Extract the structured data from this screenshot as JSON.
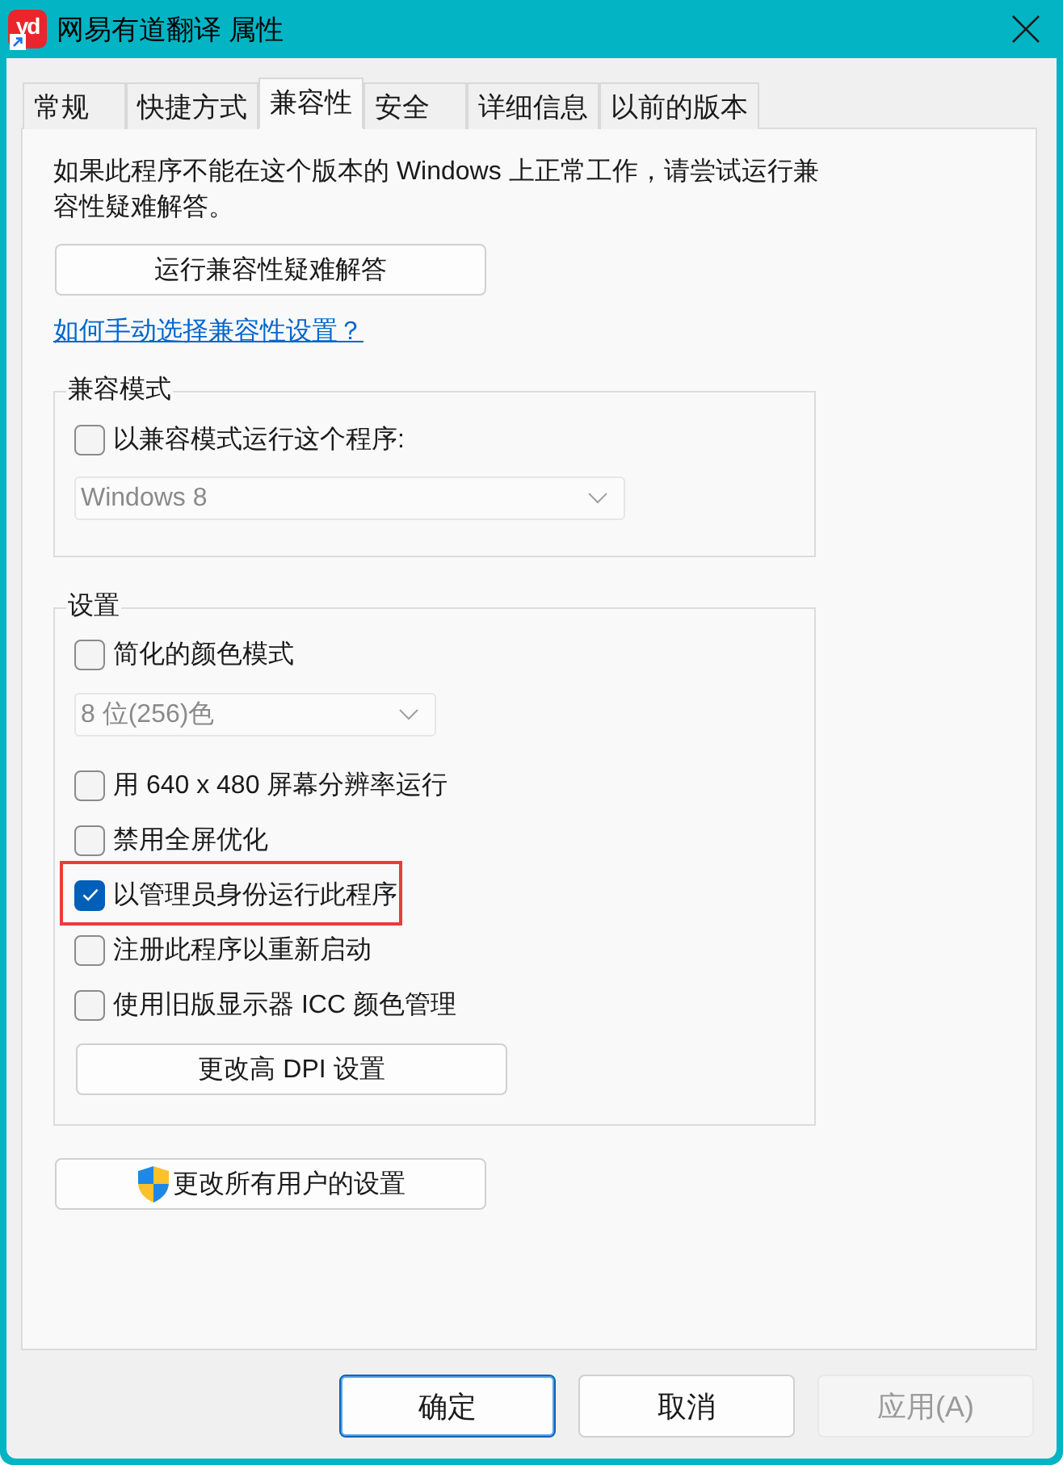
{
  "window": {
    "title": "网易有道翻译 属性",
    "logo_text": "yd"
  },
  "tabs": [
    {
      "label": "常规",
      "selected": false
    },
    {
      "label": "快捷方式",
      "selected": false
    },
    {
      "label": "兼容性",
      "selected": true
    },
    {
      "label": "安全",
      "selected": false
    },
    {
      "label": "详细信息",
      "selected": false
    },
    {
      "label": "以前的版本",
      "selected": false
    }
  ],
  "compatibility": {
    "description": "如果此程序不能在这个版本的 Windows 上正常工作，请尝试运行兼容性疑难解答。",
    "troubleshoot_button": "运行兼容性疑难解答",
    "help_link": "如何手动选择兼容性设置？",
    "mode_group": {
      "legend": "兼容模式",
      "option": {
        "label": "以兼容模式运行这个程序:",
        "checked": false
      },
      "dropdown": {
        "value": "Windows 8",
        "disabled": true
      }
    },
    "settings_group": {
      "legend": "设置",
      "items": [
        {
          "kind": "checkbox",
          "label": "简化的颜色模式",
          "checked": false,
          "highlighted": false
        },
        {
          "kind": "dropdown",
          "value": "8 位(256)色",
          "disabled": true
        },
        {
          "kind": "checkbox",
          "label": "用 640 x 480 屏幕分辨率运行",
          "checked": false,
          "highlighted": false
        },
        {
          "kind": "checkbox",
          "label": "禁用全屏优化",
          "checked": false,
          "highlighted": false
        },
        {
          "kind": "checkbox",
          "label": "以管理员身份运行此程序",
          "checked": true,
          "highlighted": true
        },
        {
          "kind": "checkbox",
          "label": "注册此程序以重新启动",
          "checked": false,
          "highlighted": false
        },
        {
          "kind": "checkbox",
          "label": "使用旧版显示器 ICC 颜色管理",
          "checked": false,
          "highlighted": false
        },
        {
          "kind": "button",
          "label": "更改高 DPI 设置"
        }
      ]
    },
    "all_users_button": "更改所有用户的设置"
  },
  "buttons": [
    {
      "label": "确定",
      "default": true,
      "disabled": false
    },
    {
      "label": "取消",
      "default": false,
      "disabled": false
    },
    {
      "label": "应用(A)",
      "default": false,
      "disabled": true
    }
  ]
}
